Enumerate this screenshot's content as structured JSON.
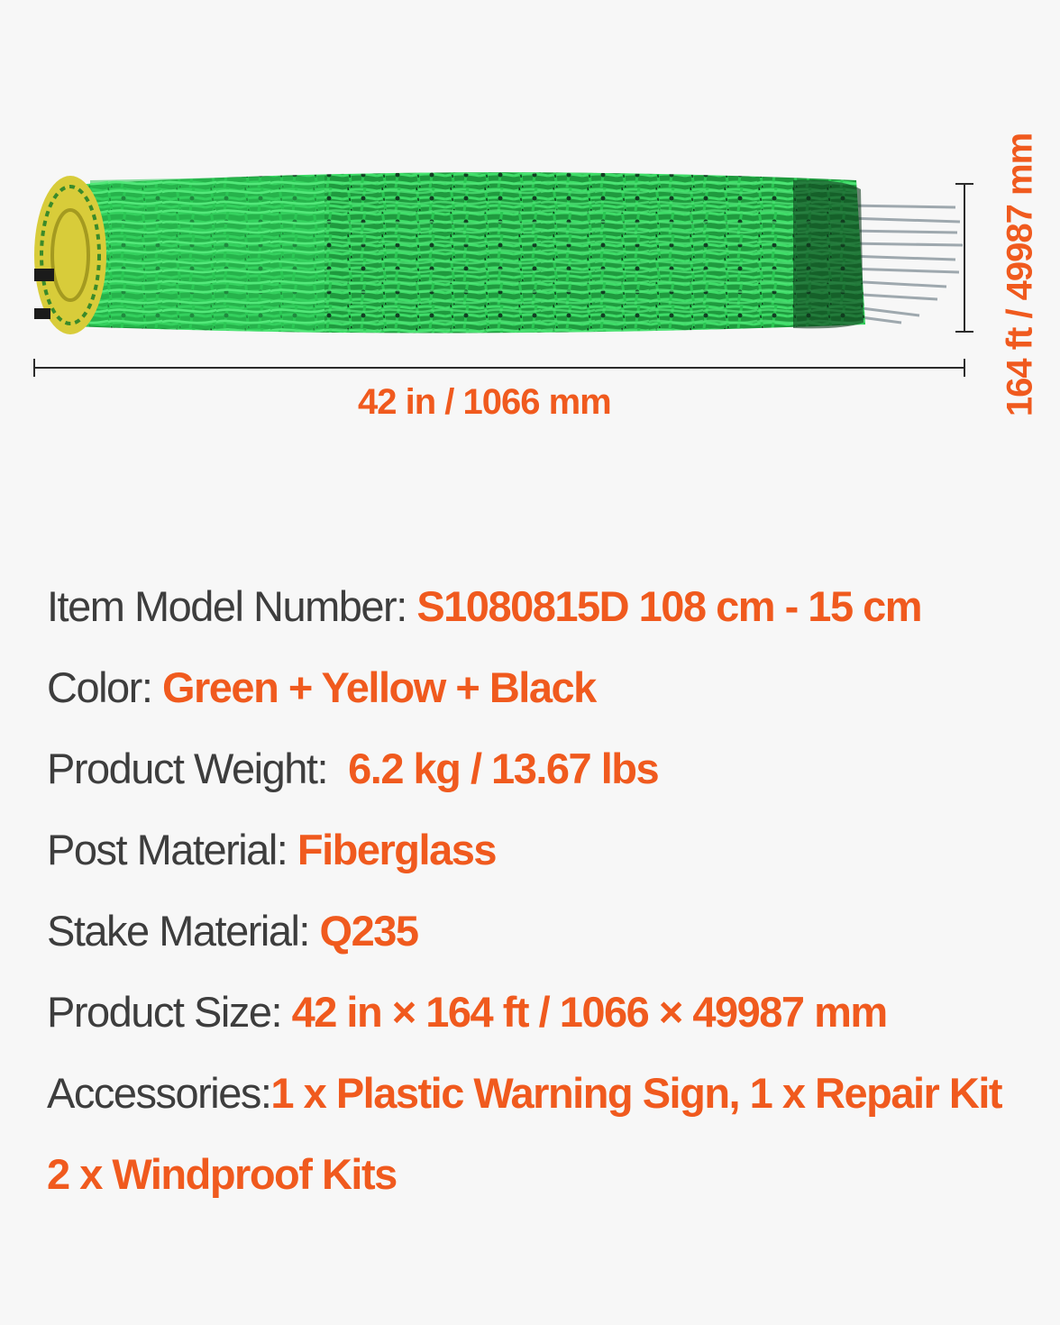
{
  "colors": {
    "accent": "#f05a1e",
    "label_text": "#3d3d3d",
    "background": "#f7f7f7",
    "net_green": "#22b24c",
    "net_yellow": "#e2d23c"
  },
  "product_image": {
    "icon": "fence-net-roll-image"
  },
  "dimensions": {
    "width_label": "42 in / 1066 mm",
    "height_label": "164 ft / 49987 mm"
  },
  "specs": [
    {
      "label": "Item Model Number: ",
      "value": "S1080815D 108 cm - 15 cm"
    },
    {
      "label": "Color: ",
      "value": "Green + Yellow + Black"
    },
    {
      "label": "Product Weight:  ",
      "value": "6.2 kg / 13.67 lbs"
    },
    {
      "label": "Post Material: ",
      "value": "Fiberglass"
    },
    {
      "label": "Stake Material: ",
      "value": "Q235"
    },
    {
      "label": "Product Size: ",
      "value": "42 in × 164 ft / 1066 × 49987 mm"
    },
    {
      "label": "Accessories:",
      "value": "1 x Plastic Warning Sign, 1 x Repair Kit"
    },
    {
      "label": "",
      "value": "2 x Windproof Kits"
    }
  ]
}
